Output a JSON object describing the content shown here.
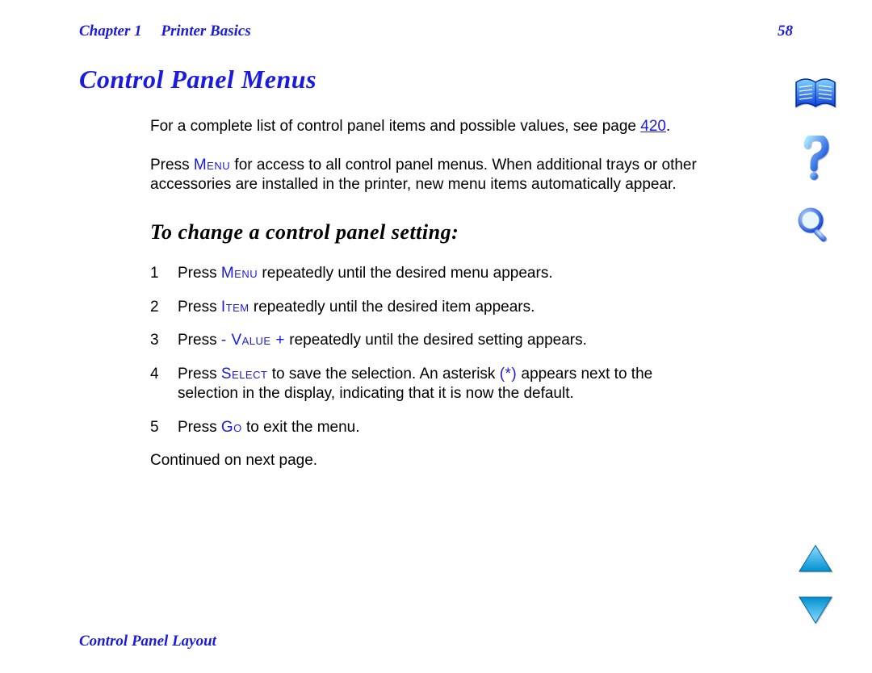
{
  "header": {
    "chapter_label": "Chapter 1",
    "chapter_title": "Printer Basics",
    "page_number": "58"
  },
  "section": {
    "title": "Control Panel Menus",
    "intro_before_link": "For a complete list of control panel items and possible values, see page ",
    "intro_link": "420",
    "intro_after_link": ".",
    "para2_a": "Press ",
    "para2_key": "Menu",
    "para2_b": " for access to all control panel menus. When additional trays or other accessories are installed in the printer, new menu items automatically appear."
  },
  "subheading": "To change a control panel setting:",
  "steps": [
    {
      "n": "1",
      "a": "Press ",
      "key": "Menu",
      "b": " repeatedly until the desired menu appears."
    },
    {
      "n": "2",
      "a": "Press ",
      "key": "Item",
      "b": " repeatedly until the desired item appears."
    },
    {
      "n": "3",
      "a": "Press ",
      "key": "- Value +",
      "b": " repeatedly until the desired setting appears."
    },
    {
      "n": "4",
      "a": "Press ",
      "key": "Select",
      "b": " to save the selection. An asterisk ",
      "key2": "(*)",
      "c": " appears next to the selection in the display, indicating that it is now the default."
    },
    {
      "n": "5",
      "a": "Press ",
      "key": "Go",
      "b": " to exit the menu."
    }
  ],
  "continued": "Continued on next page.",
  "footer": "Control Panel Layout",
  "icons": {
    "contents": "contents-book-icon",
    "help": "help-question-icon",
    "search": "search-magnifier-icon",
    "prev": "previous-page-icon",
    "next": "next-page-icon"
  }
}
